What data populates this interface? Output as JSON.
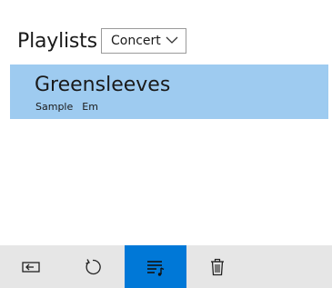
{
  "header": {
    "title": "Playlists"
  },
  "mode_dropdown": {
    "selected": "Concert"
  },
  "playlist": {
    "items": [
      {
        "title": "Greensleeves",
        "tag": "Sample",
        "key": "Em"
      }
    ]
  },
  "toolbar": {
    "buttons": [
      {
        "icon": "back-to-window-icon"
      },
      {
        "icon": "refresh-icon"
      },
      {
        "icon": "playlist-music-icon",
        "active": true
      },
      {
        "icon": "delete-icon"
      }
    ]
  },
  "colors": {
    "selection": "#9ecbf0",
    "toolbar_bg": "#e6e6e6",
    "accent": "#0078d7"
  }
}
